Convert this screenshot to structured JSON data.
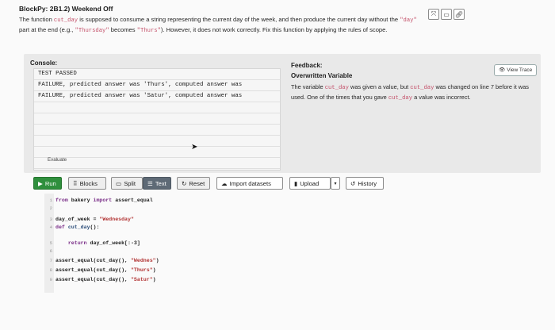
{
  "header": {
    "title": "BlockPy: 2B1.2) Weekend Off",
    "description": [
      {
        "text": "The function ",
        "code": false
      },
      {
        "text": "cut_day",
        "code": true
      },
      {
        "text": " is supposed to consume a string representing the current day of the week, and then produce the current day without the ",
        "code": false
      },
      {
        "text": "\"day\"",
        "code": true
      },
      {
        "text": " part at the end (e.g., ",
        "code": false
      },
      {
        "text": "\"Thursday\"",
        "code": true
      },
      {
        "text": " becomes ",
        "code": false
      },
      {
        "text": "\"Thurs\"",
        "code": true
      },
      {
        "text": "). However, it does not work correctly. Fix this function by applying the rules of scope.",
        "code": false
      }
    ],
    "icons": [
      "shrink-icon",
      "window-icon",
      "link-icon"
    ]
  },
  "console": {
    "label": "Console:",
    "lines": [
      "TEST PASSED",
      "FAILURE, predicted answer was 'Thurs', computed answer was",
      "FAILURE, predicted answer was 'Satur', computed answer was",
      "",
      "",
      "",
      "",
      "",
      ""
    ],
    "evaluate_label": "Evaluate"
  },
  "feedback": {
    "label": "Feedback:",
    "view_trace": "View Trace",
    "title": "Overwritten Variable",
    "body": [
      {
        "text": "The variable ",
        "code": false
      },
      {
        "text": "cut_day",
        "code": true
      },
      {
        "text": " was given a value, but ",
        "code": false
      },
      {
        "text": "cut_day",
        "code": true
      },
      {
        "text": " was changed on line 7 before it was used. One of the times that you gave ",
        "code": false
      },
      {
        "text": "cut_day",
        "code": true
      },
      {
        "text": " a value was incorrect.",
        "code": false
      }
    ]
  },
  "toolbar": {
    "run": "Run",
    "blocks": "Blocks",
    "split": "Split",
    "text": "Text",
    "reset": "Reset",
    "import_datasets": "Import datasets",
    "upload": "Upload",
    "history": "History"
  },
  "editor": {
    "lines": [
      {
        "n": "1",
        "tokens": [
          [
            "kw",
            "from "
          ],
          [
            "id",
            "bakery "
          ],
          [
            "kw",
            "import "
          ],
          [
            "id",
            "assert_equal"
          ]
        ]
      },
      {
        "n": "2",
        "tokens": []
      },
      {
        "n": "3",
        "tokens": [
          [
            "id",
            "day_of_week "
          ],
          [
            "id",
            "= "
          ],
          [
            "str",
            "\"Wednesday\""
          ]
        ]
      },
      {
        "n": "4",
        "tokens": [
          [
            "kw",
            "def "
          ],
          [
            "fn",
            "cut_day"
          ],
          [
            "id",
            "():"
          ]
        ]
      },
      {
        "n": "5",
        "tokens": [
          [
            "id",
            "    "
          ],
          [
            "kw",
            "return "
          ],
          [
            "id",
            "day_of_week[:-3]"
          ]
        ]
      },
      {
        "n": "6",
        "tokens": []
      },
      {
        "n": "7",
        "tokens": [
          [
            "id",
            "assert_equal(cut_day(), "
          ],
          [
            "str",
            "\"Wednes\""
          ],
          [
            "id",
            ")"
          ]
        ]
      },
      {
        "n": "8",
        "tokens": [
          [
            "id",
            "assert_equal(cut_day(), "
          ],
          [
            "str",
            "\"Thurs\""
          ],
          [
            "id",
            ")"
          ]
        ]
      },
      {
        "n": "9",
        "tokens": [
          [
            "id",
            "assert_equal(cut_day(), "
          ],
          [
            "str",
            "\"Satur\""
          ],
          [
            "id",
            ")"
          ]
        ]
      }
    ]
  }
}
